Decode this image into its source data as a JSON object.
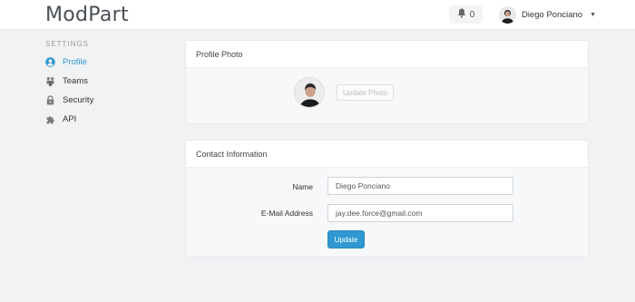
{
  "app": {
    "brand": "ModPart"
  },
  "header": {
    "notifications_count": "0",
    "user_name": "Diego Ponciano"
  },
  "sidebar": {
    "heading": "SETTINGS",
    "items": [
      {
        "label": "Profile",
        "icon": "user-circle-icon",
        "active": true
      },
      {
        "label": "Teams",
        "icon": "users-icon",
        "active": false
      },
      {
        "label": "Security",
        "icon": "lock-icon",
        "active": false
      },
      {
        "label": "API",
        "icon": "puzzle-icon",
        "active": false
      }
    ]
  },
  "profile_photo": {
    "title": "Profile Photo",
    "button_label": "Update Photo"
  },
  "contact": {
    "title": "Contact Information",
    "name_label": "Name",
    "name_value": "Diego Ponciano",
    "email_label": "E-Mail Address",
    "email_value": "jay.dee.force@gmail.com",
    "submit_label": "Update"
  },
  "colors": {
    "accent": "#3097d1",
    "background": "#f1f2f4",
    "panel_body": "#f7f8fa"
  }
}
